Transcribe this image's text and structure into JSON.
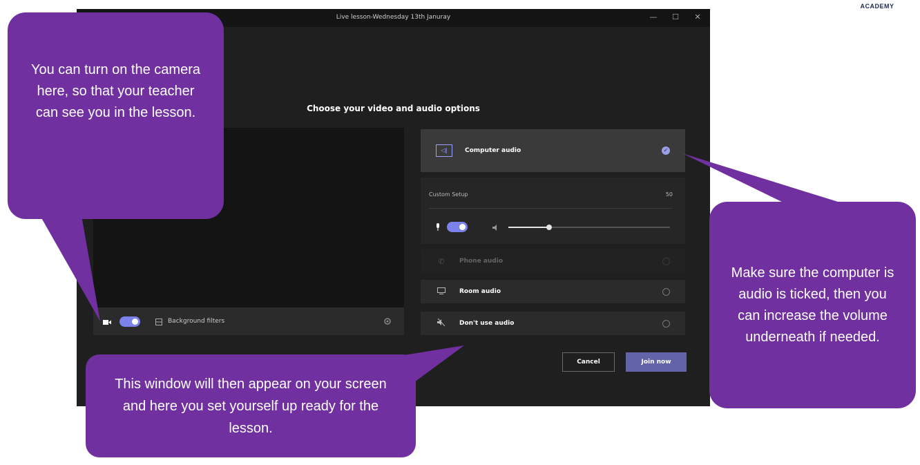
{
  "brand": {
    "text": "ACADEMY"
  },
  "window": {
    "title": "Live lesson-Wednesday 13th Januray",
    "minimize_glyph": "—",
    "maximize_glyph": "☐",
    "close_glyph": "✕"
  },
  "dialog": {
    "heading": "Choose your video and audio options",
    "background_filters": "Background filters",
    "audio_options": {
      "computer_audio": "Computer audio",
      "custom_setup": "Custom Setup",
      "custom_setup_value": "50",
      "phone_audio": "Phone audio",
      "room_audio": "Room audio",
      "dont_use_audio": "Don't use audio"
    },
    "volume_level": 0.25,
    "buttons": {
      "cancel": "Cancel",
      "join": "Join now"
    }
  },
  "callouts": {
    "camera": "You can turn on the camera here, so that your teacher can see you in the lesson.",
    "window": "This window will then appear on your screen and here you set yourself up ready for the lesson.",
    "audio": "Make sure the computer is audio is ticked, then you can increase the volume underneath if needed."
  },
  "colors": {
    "callout": "#7030a0",
    "accent": "#6264a7",
    "dialog_bg": "#1f1f1f"
  }
}
